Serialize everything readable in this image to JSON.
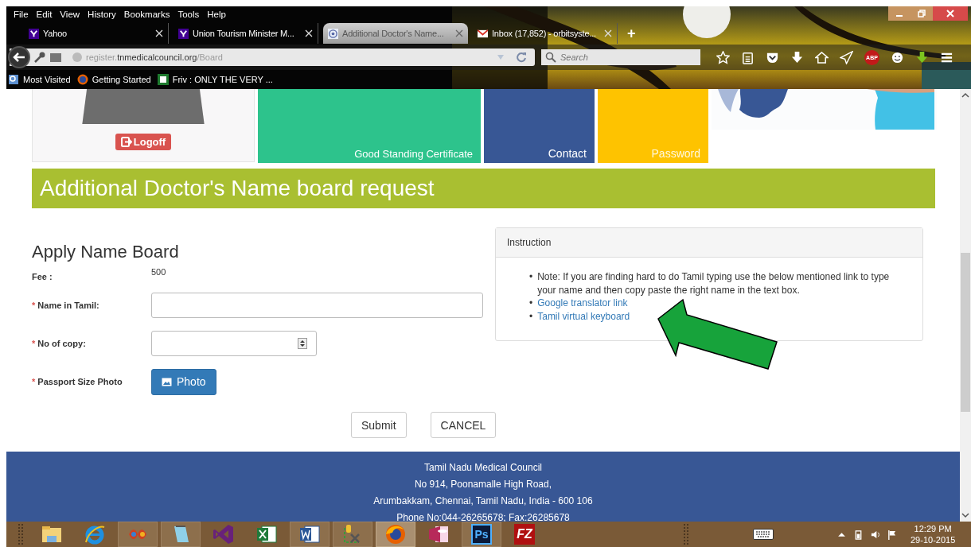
{
  "menu": [
    "File",
    "Edit",
    "View",
    "History",
    "Bookmarks",
    "Tools",
    "Help"
  ],
  "tabs": [
    {
      "title": "Yahoo",
      "kind": "yahoo",
      "selected": false
    },
    {
      "title": "Union Tourism Minister M...",
      "kind": "yahoo",
      "selected": false
    },
    {
      "title": "Additional Doctor's Name...",
      "kind": "seal",
      "selected": true
    },
    {
      "title": "Inbox (17,852) - orbitsyste...",
      "kind": "mail",
      "selected": false
    }
  ],
  "new_tab": "+",
  "address": {
    "prefix": "register.",
    "domain": "tnmedicalcouncil.org",
    "path": "/Board"
  },
  "search": {
    "placeholder": "Search"
  },
  "toolbar": [
    {
      "kind": "star"
    },
    {
      "kind": "clipboard"
    },
    {
      "kind": "pocket"
    },
    {
      "kind": "download"
    },
    {
      "kind": "home"
    },
    {
      "kind": "send"
    },
    {
      "kind": "abp",
      "label": "ABP"
    },
    {
      "kind": "smiley"
    },
    {
      "kind": "green-download"
    },
    {
      "kind": "menu"
    }
  ],
  "bookmarks": [
    {
      "label": "Most Visited",
      "kind": "page"
    },
    {
      "label": "Getting Started",
      "kind": "firefox"
    },
    {
      "label": "Friv : ONLY THE VERY ...",
      "kind": "friv"
    }
  ],
  "logoff": "Logoff",
  "tiles": [
    {
      "label": "Good Standing Certificate",
      "color": "#2dc38c"
    },
    {
      "label": "Contact",
      "color": "#385795"
    },
    {
      "label": "Password",
      "color": "#fec300"
    }
  ],
  "banner": "Additional Doctor's Name board request",
  "form": {
    "title": "Apply Name Board",
    "fee_label": "Fee :",
    "fee": "500",
    "fields": [
      {
        "kind": "text",
        "marker": "*",
        "label": "Name in Tamil:"
      },
      {
        "kind": "number",
        "marker": "*",
        "label": "No of copy:"
      },
      {
        "marker": "*",
        "label": "Passport Size Photo",
        "button": "Photo"
      }
    ],
    "submit": "Submit",
    "cancel": "CANCEL"
  },
  "instruction": {
    "title": "Instruction",
    "items": [
      {
        "kind": "text",
        "bullet": "•",
        "text": "Note: If you are finding hard to do Tamil typing use the below mentioned link to type your name and then copy paste the right name in the text box."
      },
      {
        "kind": "link",
        "bullet": "•",
        "text": "Google translator link"
      },
      {
        "kind": "link",
        "bullet": "•",
        "text": "Tamil virtual keyboard"
      }
    ]
  },
  "footer": [
    "Tamil Nadu Medical Council",
    "No 914, Poonamalle High Road,",
    "Arumbakkam, Chennai, Tamil Nadu, India - 600 106",
    "Phone No:044-26265678; Fax:26285678"
  ],
  "taskbar": {
    "apps": [
      {
        "kind": "folder",
        "running": false,
        "selected": false
      },
      {
        "kind": "ie",
        "running": false,
        "selected": false
      },
      {
        "kind": "ribbon",
        "running": true,
        "selected": false
      },
      {
        "kind": "notepad",
        "running": true,
        "selected": false
      },
      {
        "kind": "vs",
        "running": false,
        "selected": false
      },
      {
        "kind": "excel",
        "running": false,
        "selected": false
      },
      {
        "kind": "word",
        "running": true,
        "selected": false
      },
      {
        "kind": "tools",
        "running": true,
        "selected": false
      },
      {
        "kind": "firefox",
        "running": true,
        "selected": true
      },
      {
        "kind": "access",
        "running": false,
        "selected": false
      },
      {
        "kind": "ps",
        "label": "Ps",
        "running": true,
        "selected": false
      },
      {
        "kind": "filezilla",
        "label": "FZ",
        "running": false,
        "selected": false
      }
    ],
    "time": "12:29 PM",
    "date": "29-10-2015"
  }
}
